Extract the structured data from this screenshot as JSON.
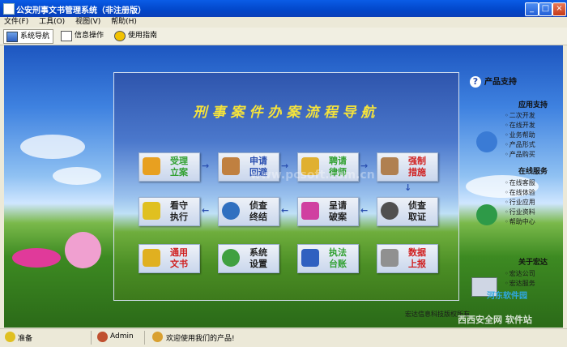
{
  "window": {
    "title": "公安刑事文书管理系统（非注册版）",
    "buttons": [
      "_",
      "□",
      "×"
    ]
  },
  "menu": [
    "文件(F)",
    "工具(O)",
    "视图(V)",
    "帮助(H)"
  ],
  "tabs": [
    {
      "label": "系统导航",
      "icon": "nav-icon",
      "active": true
    },
    {
      "label": "信息操作",
      "icon": "info-icon",
      "active": false
    },
    {
      "label": "使用指南",
      "icon": "help-icon",
      "active": false
    }
  ],
  "panel": {
    "title": "刑事案件办案流程导航",
    "buttons": [
      {
        "label": "受理\n立案",
        "icon": "file-accept-icon",
        "color": "#30a030",
        "icon_color": "#e8a020"
      },
      {
        "label": "申请\n回避",
        "icon": "walking-person-icon",
        "color": "#2a4fb0",
        "icon_color": "#c08040"
      },
      {
        "label": "聘请\n律师",
        "icon": "coins-icon",
        "color": "#30a030",
        "icon_color": "#e0b030"
      },
      {
        "label": "强制\n措施",
        "icon": "lamp-icon",
        "color": "#d02020",
        "icon_color": "#b08050"
      },
      {
        "label": "看守\n执行",
        "icon": "warning-sign-icon",
        "color": "#222222",
        "icon_color": "#e0c020"
      },
      {
        "label": "侦查\n终结",
        "icon": "globe-icon",
        "color": "#222222",
        "icon_color": "#3070c0"
      },
      {
        "label": "呈请\n破案",
        "icon": "music-note-icon",
        "color": "#222222",
        "icon_color": "#d040a0"
      },
      {
        "label": "侦查\n取证",
        "icon": "magnifier-icon",
        "color": "#222222",
        "icon_color": "#505050"
      },
      {
        "label": "通用\n文书",
        "icon": "folders-icon",
        "color": "#d02020",
        "icon_color": "#e0b020"
      },
      {
        "label": "系统\n设置",
        "icon": "gears-icon",
        "color": "#222222",
        "icon_color": "#40a040"
      },
      {
        "label": "执法\n台账",
        "icon": "books-icon",
        "color": "#30a030",
        "icon_color": "#3060c0"
      },
      {
        "label": "数据\n上报",
        "icon": "server-icon",
        "color": "#d02020",
        "icon_color": "#909090"
      }
    ],
    "arrows": [
      "→",
      "→",
      "→",
      "↓",
      "←",
      "←",
      "←"
    ]
  },
  "sidebar": {
    "title": "产品支持",
    "sections": [
      {
        "title": "应用支持",
        "links": [
          "二次开发",
          "在线开发",
          "业务帮助",
          "产品形式",
          "产品购买"
        ]
      },
      {
        "title": "在线服务",
        "links": [
          "在线客服",
          "在线体验",
          "行业应用",
          "行业资料",
          "帮助中心"
        ]
      },
      {
        "title": "关于宏达",
        "links": [
          "宏达公司",
          "宏达服务"
        ]
      }
    ]
  },
  "copyright": "宏达信息科技版权所有",
  "watermarks": [
    "www.pcsoft.com.cn",
    "河东软件园",
    "西西安全网 软件站"
  ],
  "status": {
    "ready": "准备",
    "user": "Admin",
    "message": "欢迎使用我们的产品!"
  }
}
